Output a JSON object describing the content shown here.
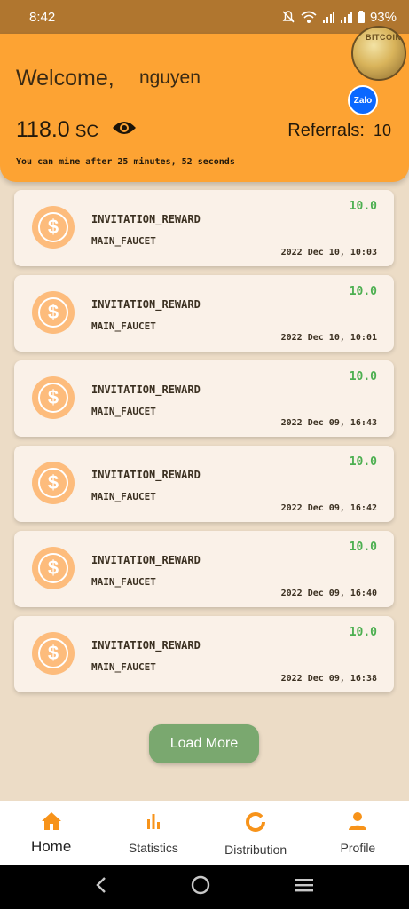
{
  "status": {
    "time": "8:42",
    "battery": "93%"
  },
  "header": {
    "welcome": "Welcome,",
    "username": "nguyen",
    "balance": "118.0",
    "unit": "SC",
    "referrals_label": "Referrals:",
    "referrals_count": "10",
    "countdown": "You can mine after 25 minutes, 52 seconds",
    "badge_text": "BITCOIN",
    "zalo_label": "Zalo"
  },
  "transactions": [
    {
      "type": "INVITATION_REWARD",
      "source": "MAIN_FAUCET",
      "amount": "10.0",
      "date": "2022 Dec 10, 10:03"
    },
    {
      "type": "INVITATION_REWARD",
      "source": "MAIN_FAUCET",
      "amount": "10.0",
      "date": "2022 Dec 10, 10:01"
    },
    {
      "type": "INVITATION_REWARD",
      "source": "MAIN_FAUCET",
      "amount": "10.0",
      "date": "2022 Dec 09, 16:43"
    },
    {
      "type": "INVITATION_REWARD",
      "source": "MAIN_FAUCET",
      "amount": "10.0",
      "date": "2022 Dec 09, 16:42"
    },
    {
      "type": "INVITATION_REWARD",
      "source": "MAIN_FAUCET",
      "amount": "10.0",
      "date": "2022 Dec 09, 16:40"
    },
    {
      "type": "INVITATION_REWARD",
      "source": "MAIN_FAUCET",
      "amount": "10.0",
      "date": "2022 Dec 09, 16:38"
    }
  ],
  "load_more_label": "Load More",
  "nav": {
    "home": "Home",
    "statistics": "Statistics",
    "distribution": "Distribution",
    "profile": "Profile"
  },
  "colors": {
    "accent": "#fda333",
    "amount": "#4caf50",
    "load_more": "#7aa86f",
    "coin": "#fdbc7c"
  },
  "icons": {
    "status": [
      "bell-off-icon",
      "wifi-icon",
      "signal-icon",
      "signal-icon",
      "battery-icon"
    ],
    "header": [
      "eye-icon",
      "bitcoin-badge-icon",
      "zalo-icon"
    ],
    "card": "dollar-coin-icon",
    "nav": [
      "home-icon",
      "bar-chart-icon",
      "donut-icon",
      "person-icon"
    ],
    "system": [
      "back-icon",
      "home-circle-icon",
      "recents-icon"
    ]
  }
}
